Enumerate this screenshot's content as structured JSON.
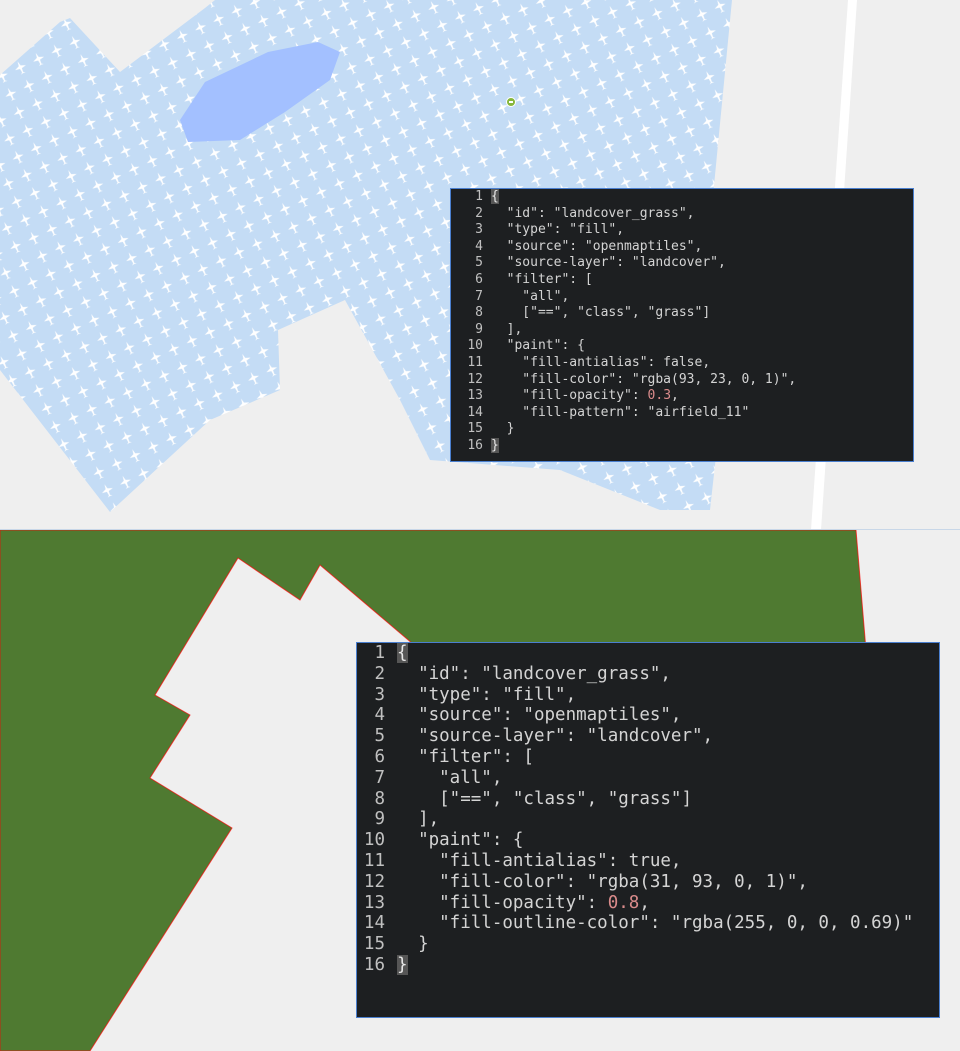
{
  "colors": {
    "background": "#efefef",
    "grass_pattern_fill": "#c4dcf5",
    "airfield_icon": "#ffffff",
    "water": "#a3c0ff",
    "road": "#ffffff",
    "grass_solid_fill": "#4f7a31",
    "grass_outline": "#ff0000",
    "editor_background": "#1d1f21",
    "editor_border": "#4a7fcf",
    "number_literal": "#d98b8b"
  },
  "icons": {
    "map_marker": "location-marker-icon",
    "pattern": "airfield-icon"
  },
  "top_editor": {
    "lines": [
      {
        "no": "1",
        "text": "{"
      },
      {
        "no": "2",
        "text": "  \"id\": \"landcover_grass\","
      },
      {
        "no": "3",
        "text": "  \"type\": \"fill\","
      },
      {
        "no": "4",
        "text": "  \"source\": \"openmaptiles\","
      },
      {
        "no": "5",
        "text": "  \"source-layer\": \"landcover\","
      },
      {
        "no": "6",
        "text": "  \"filter\": ["
      },
      {
        "no": "7",
        "text": "    \"all\","
      },
      {
        "no": "8",
        "text": "    [\"==\", \"class\", \"grass\"]"
      },
      {
        "no": "9",
        "text": "  ],"
      },
      {
        "no": "10",
        "text": "  \"paint\": {"
      },
      {
        "no": "11",
        "text": "    \"fill-antialias\": false,"
      },
      {
        "no": "12",
        "text": "    \"fill-color\": \"rgba(93, 23, 0, 1)\","
      },
      {
        "no": "13",
        "pre": "    \"fill-opacity\": ",
        "num": "0.3",
        "post": ","
      },
      {
        "no": "14",
        "text": "    \"fill-pattern\": \"airfield_11\""
      },
      {
        "no": "15",
        "text": "  }"
      },
      {
        "no": "16",
        "text": "}"
      }
    ]
  },
  "bottom_editor": {
    "lines": [
      {
        "no": "1",
        "text": "{"
      },
      {
        "no": "2",
        "text": "  \"id\": \"landcover_grass\","
      },
      {
        "no": "3",
        "text": "  \"type\": \"fill\","
      },
      {
        "no": "4",
        "text": "  \"source\": \"openmaptiles\","
      },
      {
        "no": "5",
        "text": "  \"source-layer\": \"landcover\","
      },
      {
        "no": "6",
        "text": "  \"filter\": ["
      },
      {
        "no": "7",
        "text": "    \"all\","
      },
      {
        "no": "8",
        "text": "    [\"==\", \"class\", \"grass\"]"
      },
      {
        "no": "9",
        "text": "  ],"
      },
      {
        "no": "10",
        "text": "  \"paint\": {"
      },
      {
        "no": "11",
        "text": "    \"fill-antialias\": true,"
      },
      {
        "no": "12",
        "text": "    \"fill-color\": \"rgba(31, 93, 0, 1)\","
      },
      {
        "no": "13",
        "pre": "    \"fill-opacity\": ",
        "num": "0.8",
        "post": ","
      },
      {
        "no": "14",
        "text": "    \"fill-outline-color\": \"rgba(255, 0, 0, 0.69)\""
      },
      {
        "no": "15",
        "text": "  }"
      },
      {
        "no": "16",
        "text": "}"
      }
    ]
  }
}
